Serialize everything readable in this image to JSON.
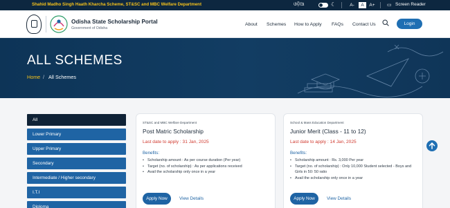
{
  "topbar": {
    "tagline": "Shahid Madho Singh Haath Kharcha Scheme, ST&SC and MBC Welfare Department",
    "language": "ଓଡ଼ିଆ",
    "font_small": "A-",
    "font_normal": "A",
    "font_large": "A+",
    "screen_reader": "Screen Reader",
    "screen_reader_icon": "screen-reader-icon",
    "theme_icon": "moon-icon"
  },
  "header": {
    "title": "Odisha State Scholarship Portal",
    "subtitle": "Government of Odisha",
    "nav": [
      "About",
      "Schemes",
      "How to Apply",
      "FAQs",
      "Contact Us"
    ],
    "search_icon": "search-icon",
    "login_label": "Login"
  },
  "hero": {
    "title": "ALL SCHEMES",
    "breadcrumb_home": "Home",
    "breadcrumb_sep": "/",
    "breadcrumb_current": "All Schemes"
  },
  "sidebar": {
    "items": [
      {
        "label": "All",
        "active": true
      },
      {
        "label": "Lower Primary",
        "active": false
      },
      {
        "label": "Upper Primary",
        "active": false
      },
      {
        "label": "Secondary",
        "active": false
      },
      {
        "label": "Intermediate / Higher secondary",
        "active": false
      },
      {
        "label": "I.T.I",
        "active": false
      },
      {
        "label": "Diploma",
        "active": false
      }
    ]
  },
  "cards": [
    {
      "department": "ST&SC and MBC Welfare Department",
      "name": "Post Matric Scholarship",
      "deadline": "Last date to apply : 31 Jan, 2025",
      "benefits_label": "Benefits:",
      "benefits": [
        "Scholarship amount : As per course duration (Per year)",
        "Target (no. of scholarship) : As per applications received",
        "Avail the scholarship only once in a year"
      ],
      "apply_label": "Apply Now",
      "view_label": "View Details"
    },
    {
      "department": "School & Mass Education Department",
      "name": "Junior Merit (Class - 11 to 12)",
      "deadline": "Last date to apply : 14 Jan, 2025",
      "benefits_label": "Benefits:",
      "benefits": [
        "Scholarship amount : Rs. 3,000 Per year",
        "Target (no. of scholarship) : Only 10,000 Student selected - Boys and Girls in 50: 50 ratio",
        "Avail the scholarship only once in a year"
      ],
      "apply_label": "Apply Now",
      "view_label": "View Details"
    }
  ],
  "scroll_top_icon": "arrow-up-icon",
  "colors": {
    "primary": "#1f64a4",
    "dark_navy": "#0d2740",
    "accent_yellow": "#f6c21b",
    "deadline_red": "#d0392e",
    "hero_bg": "#0d3457"
  }
}
